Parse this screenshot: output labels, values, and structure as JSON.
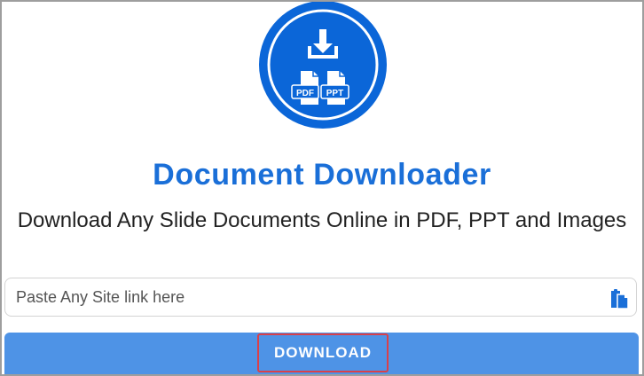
{
  "header": {
    "title": "Document Downloader",
    "subtitle": "Download Any Slide Documents Online in PDF, PPT and Images"
  },
  "logo": {
    "icon": "document-download-logo-icon",
    "badge_left": "PDF",
    "badge_right": "PPT",
    "color": "#0b66d8"
  },
  "search": {
    "placeholder": "Paste Any Site link here",
    "value": "",
    "paste_icon": "clipboard-paste-icon"
  },
  "action": {
    "download_label": "DOWNLOAD",
    "bar_color": "#4e93e6",
    "highlight_color": "#d9404a"
  },
  "colors": {
    "title": "#1a6fd8",
    "border": "#9e9e9e"
  }
}
